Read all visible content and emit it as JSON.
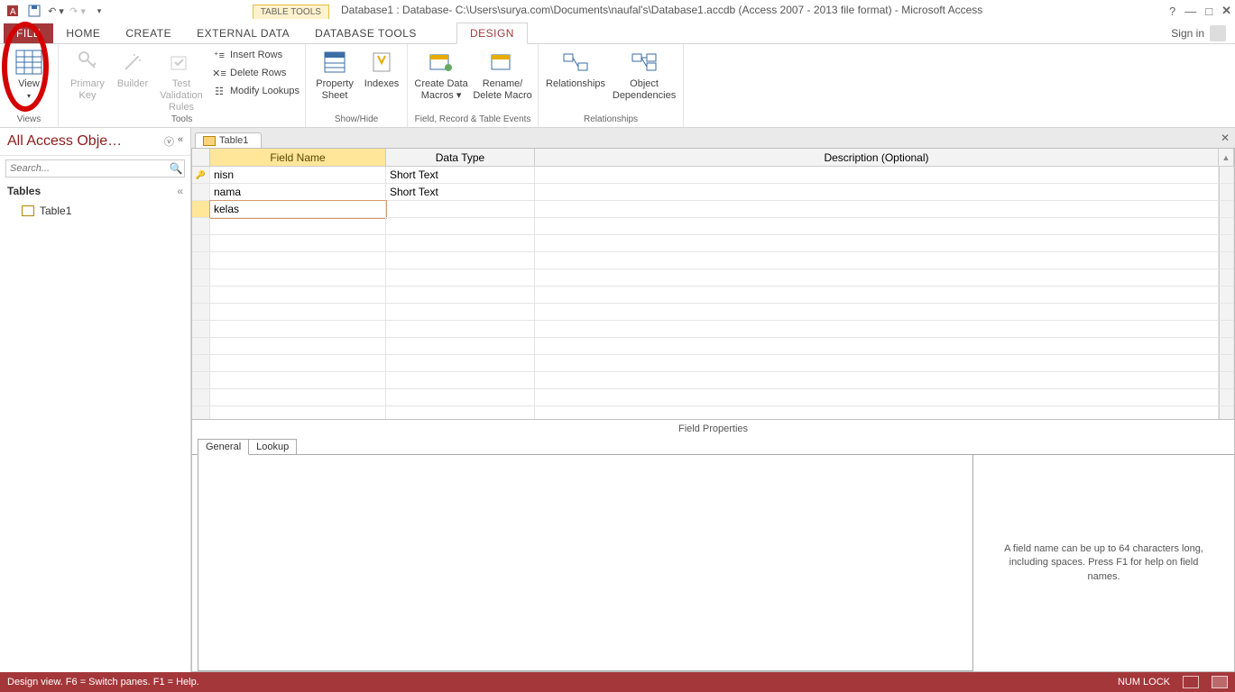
{
  "titlebar": {
    "tabletools": "TABLE TOOLS",
    "title": "Database1 : Database- C:\\Users\\surya.com\\Documents\\naufal's\\Database1.accdb (Access 2007 - 2013 file format) - Microsoft Access"
  },
  "tabs": {
    "file": "FILE",
    "home": "HOME",
    "create": "CREATE",
    "external": "EXTERNAL DATA",
    "dbtools": "DATABASE TOOLS",
    "design": "DESIGN",
    "signin": "Sign in"
  },
  "ribbon": {
    "view": "View",
    "primary": "Primary Key",
    "builder": "Builder",
    "testvr": "Test Validation Rules",
    "views_label": "Views",
    "tools_label": "Tools",
    "insert_rows": "Insert Rows",
    "delete_rows": "Delete Rows",
    "modify_lookups": "Modify Lookups",
    "property_sheet": "Property Sheet",
    "indexes": "Indexes",
    "showhide_label": "Show/Hide",
    "create_macros": "Create Data Macros ▾",
    "rename_macro": "Rename/ Delete Macro",
    "fre_label": "Field, Record & Table Events",
    "relationships": "Relationships",
    "obj_dep": "Object Dependencies",
    "rel_label": "Relationships"
  },
  "nav": {
    "header": "All Access Obje…",
    "search_placeholder": "Search...",
    "tables": "Tables",
    "table1": "Table1"
  },
  "doc": {
    "tab": "Table1",
    "col_field": "Field Name",
    "col_type": "Data Type",
    "col_desc": "Description (Optional)",
    "rows": [
      {
        "pk": true,
        "field": "nisn",
        "type": "Short Text"
      },
      {
        "pk": false,
        "field": "nama",
        "type": "Short Text"
      },
      {
        "pk": false,
        "field": "kelas",
        "type": "",
        "editing": true
      }
    ]
  },
  "props": {
    "title": "Field Properties",
    "general": "General",
    "lookup": "Lookup",
    "help": "A field name can be up to 64 characters long, including spaces. Press F1 for help on field names."
  },
  "status": {
    "left": "Design view.  F6 = Switch panes.  F1 = Help.",
    "numlock": "NUM LOCK"
  }
}
